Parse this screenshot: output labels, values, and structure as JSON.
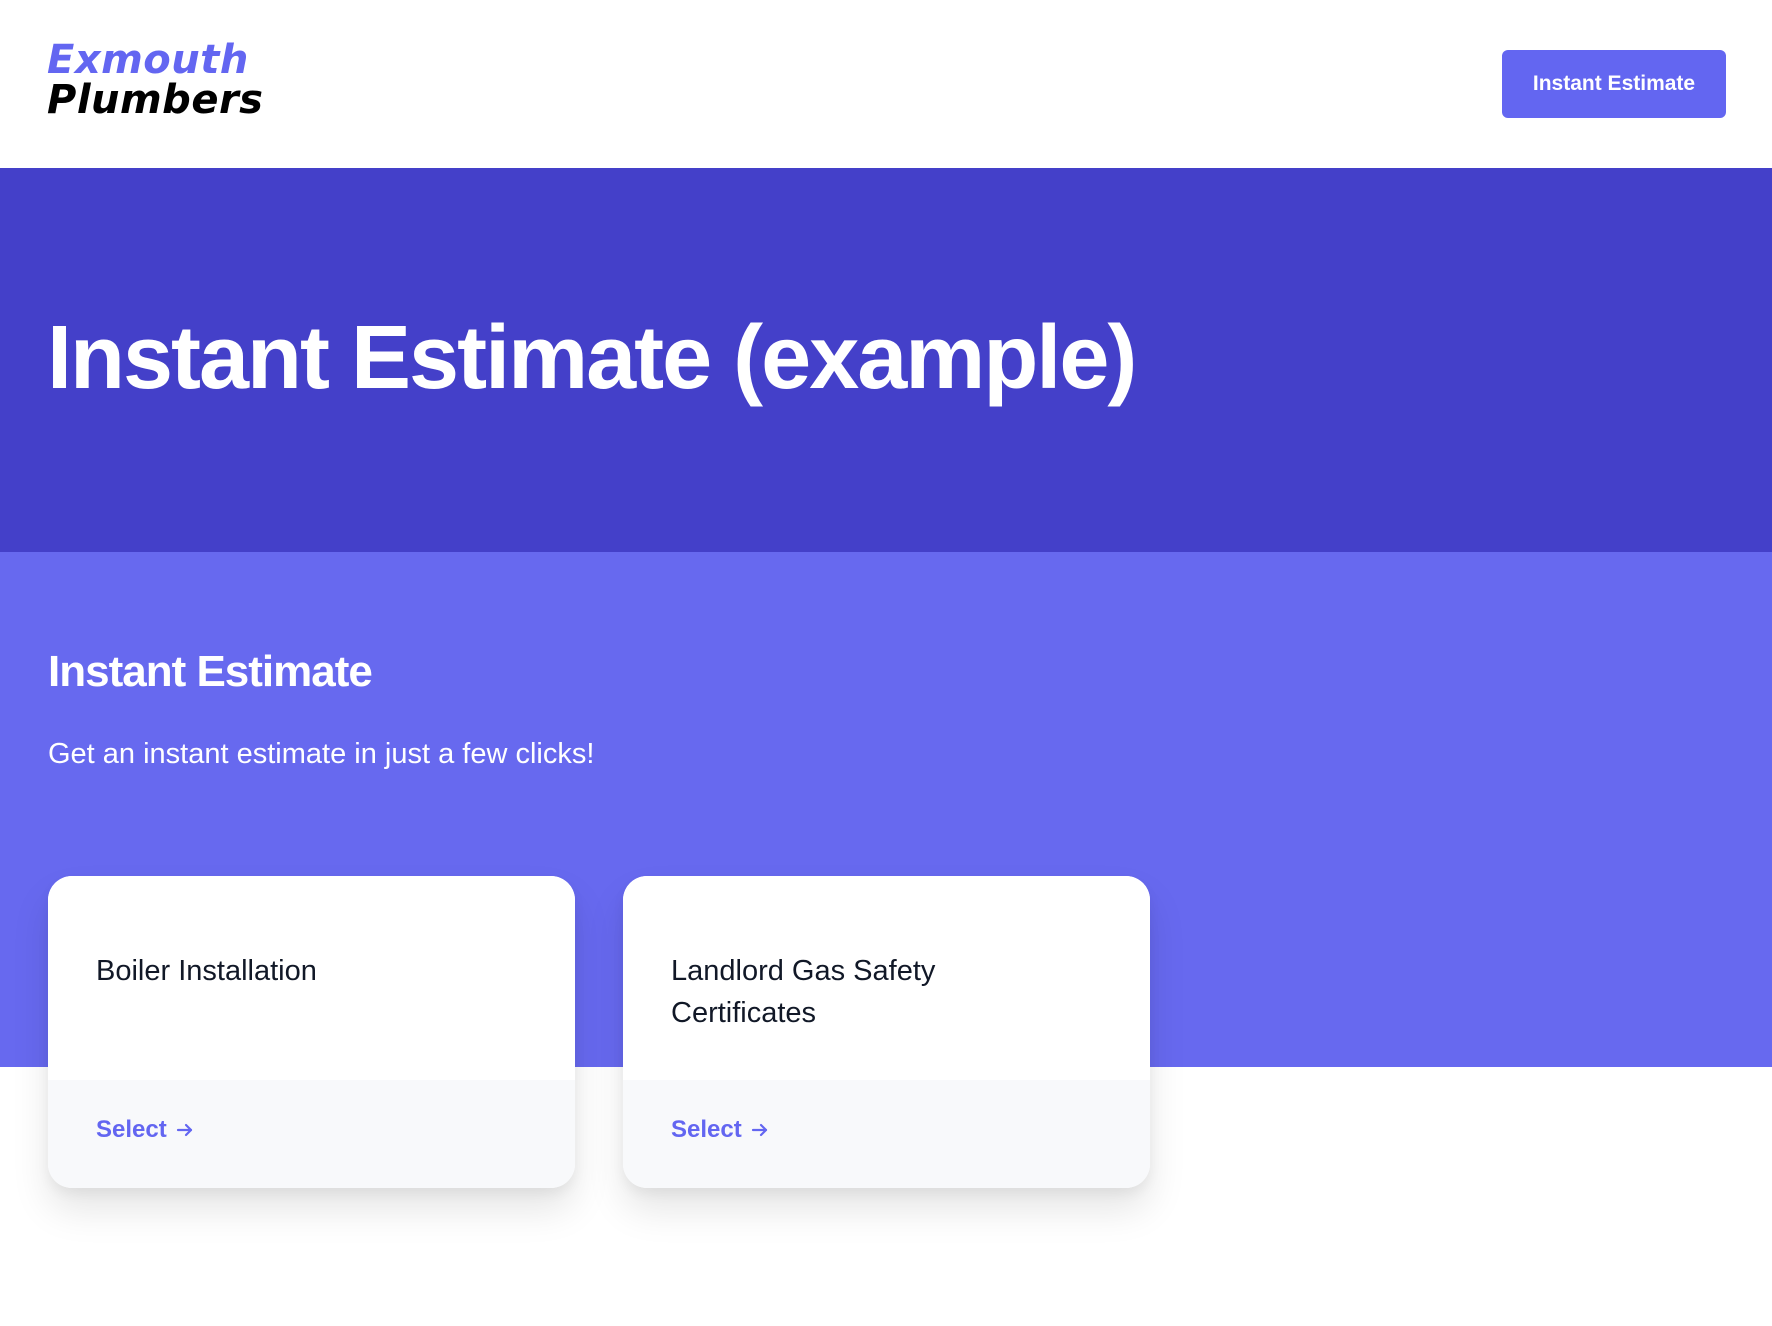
{
  "header": {
    "logo_line1": "Exmouth",
    "logo_line2": "Plumbers",
    "cta_label": "Instant Estimate"
  },
  "hero": {
    "title": "Instant Estimate (example)"
  },
  "estimate": {
    "title": "Instant Estimate",
    "subtitle": "Get an instant estimate in just a few clicks!",
    "cards": [
      {
        "title": "Boiler Installation",
        "action_label": "Select",
        "action_icon": "arrow-right-icon"
      },
      {
        "title": "Landlord Gas Safety Certificates",
        "action_label": "Select",
        "action_icon": "arrow-right-icon"
      }
    ]
  },
  "colors": {
    "brand": "#6366f1",
    "hero_bg": "#4440c9",
    "band_bg": "#6769ef",
    "text_dark": "#111827",
    "card_footer_bg": "#f8f9fb"
  }
}
